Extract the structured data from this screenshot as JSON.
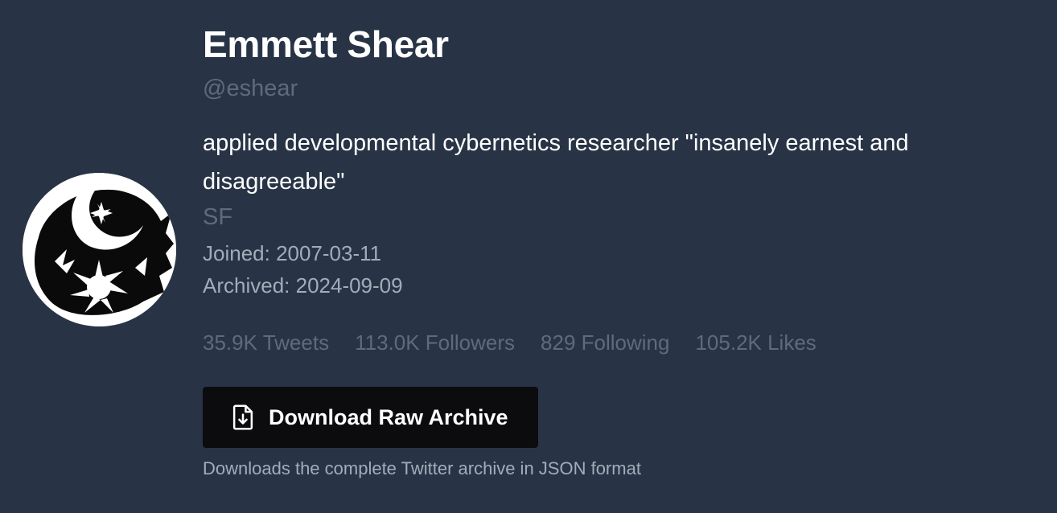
{
  "profile": {
    "name": "Emmett Shear",
    "handle": "@eshear",
    "bio": "applied developmental cybernetics researcher \"insanely earnest and disagreeable\"",
    "location": "SF",
    "joined": "Joined: 2007-03-11",
    "archived": "Archived: 2024-09-09",
    "avatar_icon": "moon-sun-avatar-icon"
  },
  "stats": {
    "tweets": "35.9K Tweets",
    "followers": "113.0K Followers",
    "following": "829 Following",
    "likes": "105.2K Likes"
  },
  "download": {
    "button_label": "Download Raw Archive",
    "icon": "file-download-icon",
    "note": "Downloads the complete Twitter archive in JSON format"
  },
  "colors": {
    "background": "#283446",
    "button": "#0c0c0e",
    "muted": "#5f6b7c",
    "secondary": "#a3acb9"
  }
}
